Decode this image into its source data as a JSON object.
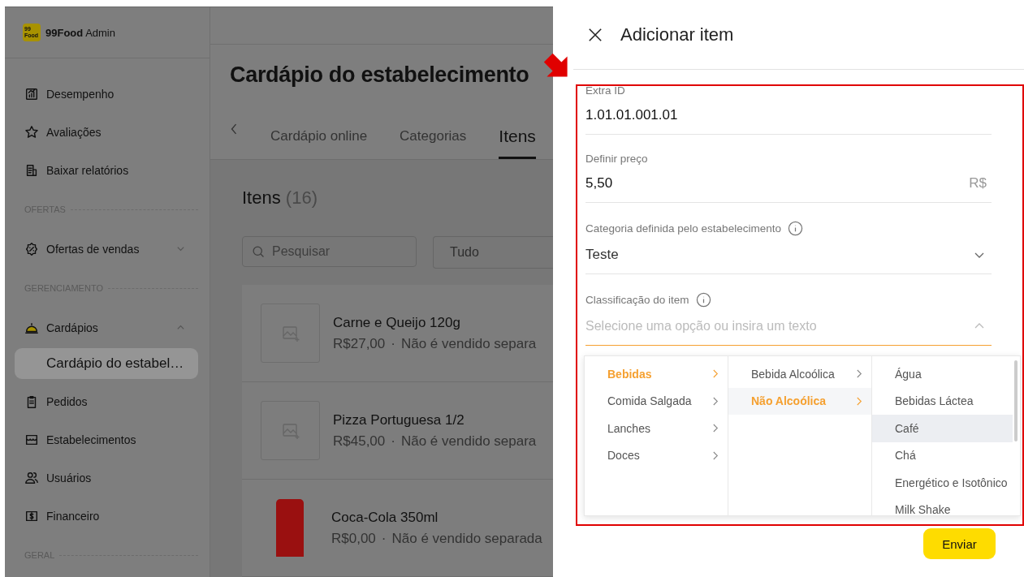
{
  "brand": {
    "logo_text": "99 Food",
    "name": "99Food",
    "suffix": "Admin"
  },
  "sidebar": [
    {
      "items": [
        {
          "label": "Desempenho",
          "selected": false
        },
        {
          "label": "Avaliações",
          "selected": false
        },
        {
          "label": "Baixar relatórios",
          "selected": false
        }
      ]
    },
    {
      "heading": "OFERTAS",
      "items": [
        {
          "label": "Ofertas de vendas",
          "selected": false,
          "expanded": false
        }
      ]
    },
    {
      "heading": "GERENCIAMENTO",
      "items": [
        {
          "label": "Cardápios",
          "selected": false,
          "expanded": true,
          "children": [
            {
              "label": "Cardápio do estabel…",
              "selected": true
            }
          ]
        },
        {
          "label": "Pedidos",
          "selected": false
        },
        {
          "label": "Estabelecimentos",
          "selected": false
        },
        {
          "label": "Usuários",
          "selected": false
        },
        {
          "label": "Financeiro",
          "selected": false
        }
      ]
    },
    {
      "heading": "GERAL"
    }
  ],
  "main": {
    "title": "Cardápio do estabelecimento",
    "tabs": [
      {
        "label": "Cardápio online",
        "selected": false
      },
      {
        "label": "Categorias",
        "selected": false
      },
      {
        "label": "Itens",
        "selected": true
      }
    ],
    "list_title": "Itens",
    "list_count": "(16)",
    "search": {
      "placeholder": "Pesquisar"
    },
    "filter": {
      "value": "Tudo"
    },
    "products": [
      {
        "name": "Carne e Queijo 120g",
        "price": "R$27,00",
        "separator": "·",
        "note": "Não é vendido separa",
        "kind": "placeholder"
      },
      {
        "name": "Pizza Portuguesa 1/2",
        "price": "R$45,00",
        "separator": "·",
        "note": "Não é vendido separa",
        "kind": "placeholder"
      },
      {
        "name": "Coca-Cola 350ml",
        "price": "R$0,00",
        "separator": "·",
        "note": "Não é vendido separada",
        "kind": "photo"
      }
    ]
  },
  "drawer": {
    "title": "Adicionar item",
    "fields": [
      {
        "kind": "text",
        "label": "Extra ID",
        "value": "1.01.01.001.01"
      },
      {
        "kind": "money",
        "label": "Definir preço",
        "value": "5,50",
        "suffix": "R$"
      },
      {
        "kind": "select",
        "label": "Categoria definida pelo estabelecimento",
        "value": "Teste",
        "expanded": false
      },
      {
        "kind": "select",
        "label": "Classificação do item",
        "placeholder": "Selecione uma opção ou insira um texto",
        "expanded": true
      }
    ],
    "cascader": [
      [
        {
          "label": "Bebidas",
          "selected": true,
          "has_children": true
        },
        {
          "label": "Comida Salgada",
          "selected": false,
          "has_children": true
        },
        {
          "label": "Lanches",
          "selected": false,
          "has_children": true
        },
        {
          "label": "Doces",
          "selected": false,
          "has_children": true
        }
      ],
      [
        {
          "label": "Bebida Alcoólica",
          "selected": false,
          "has_children": true
        },
        {
          "label": "Não Alcoólica",
          "selected": true,
          "has_children": true
        }
      ],
      [
        {
          "label": "Água",
          "selected": false,
          "hovered": false
        },
        {
          "label": "Bebidas Láctea",
          "selected": false,
          "hovered": false
        },
        {
          "label": "Café",
          "selected": false,
          "hovered": true
        },
        {
          "label": "Chá",
          "selected": false,
          "hovered": false
        },
        {
          "label": "Energético e Isotônico",
          "selected": false,
          "hovered": false
        },
        {
          "label": "Milk Shake",
          "selected": false,
          "hovered": false
        }
      ]
    ],
    "submit": "Enviar"
  }
}
